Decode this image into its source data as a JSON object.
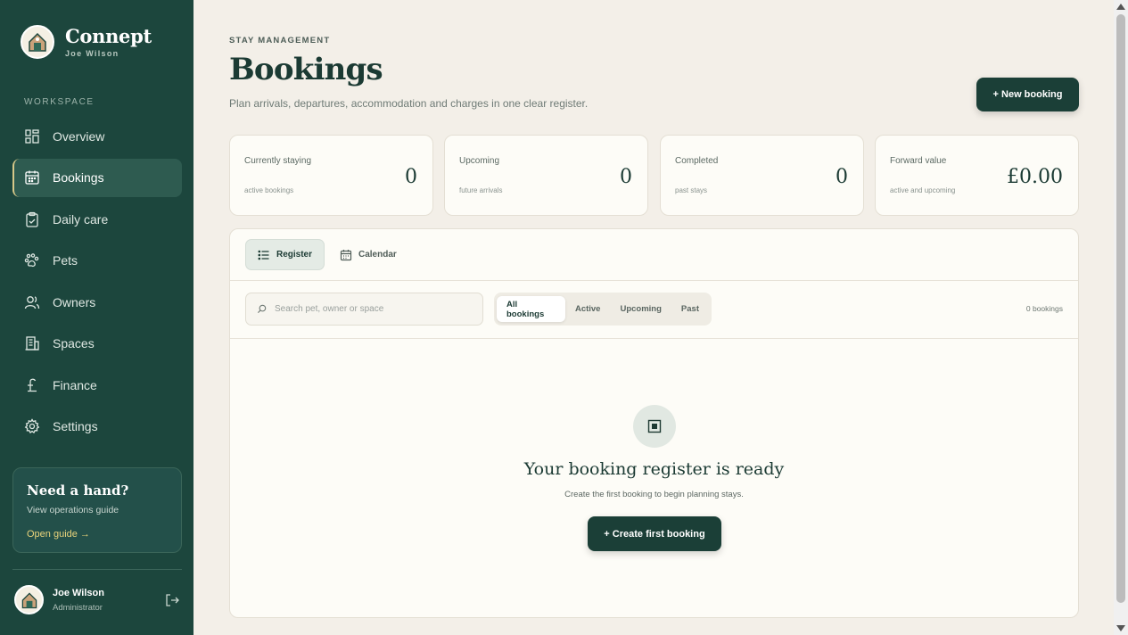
{
  "brand": {
    "name": "Connept",
    "user": "Joe Wilson"
  },
  "sidebar": {
    "section_label": "WORKSPACE",
    "items": [
      {
        "label": "Overview",
        "icon": "grid-icon"
      },
      {
        "label": "Bookings",
        "icon": "calendar-icon",
        "active": true
      },
      {
        "label": "Daily care",
        "icon": "clipboard-icon"
      },
      {
        "label": "Pets",
        "icon": "paw-icon"
      },
      {
        "label": "Owners",
        "icon": "users-icon"
      },
      {
        "label": "Spaces",
        "icon": "building-icon"
      },
      {
        "label": "Finance",
        "icon": "pound-icon"
      },
      {
        "label": "Settings",
        "icon": "gear-icon"
      }
    ],
    "help": {
      "title": "Need a hand?",
      "subtitle": "View operations guide",
      "link": "Open guide →"
    },
    "user": {
      "name": "Joe Wilson",
      "role": "Administrator"
    }
  },
  "header": {
    "eyebrow": "STAY MANAGEMENT",
    "title": "Bookings",
    "subtitle": "Plan arrivals, departures, accommodation and charges in one clear register.",
    "new_booking_label": "+ New booking"
  },
  "stats": [
    {
      "label": "Currently staying",
      "sub": "active bookings",
      "value": "0"
    },
    {
      "label": "Upcoming",
      "sub": "future arrivals",
      "value": "0"
    },
    {
      "label": "Completed",
      "sub": "past stays",
      "value": "0"
    },
    {
      "label": "Forward value",
      "sub": "active and upcoming",
      "value": "£0.00"
    }
  ],
  "panel": {
    "tabs": [
      {
        "label": "Register",
        "active": true
      },
      {
        "label": "Calendar"
      }
    ],
    "search": {
      "placeholder": "Search pet, owner or space",
      "value": ""
    },
    "filters": [
      "All bookings",
      "Active",
      "Upcoming",
      "Past"
    ],
    "active_filter": "All bookings",
    "count": "0 bookings",
    "empty": {
      "title": "Your booking register is ready",
      "subtitle": "Create the first booking to begin planning stays.",
      "button": "+ Create first booking"
    }
  },
  "colors": {
    "sidebar": "#1c463d",
    "background": "#f3efe8",
    "accent": "#d7c889",
    "button": "#1b3f37"
  }
}
